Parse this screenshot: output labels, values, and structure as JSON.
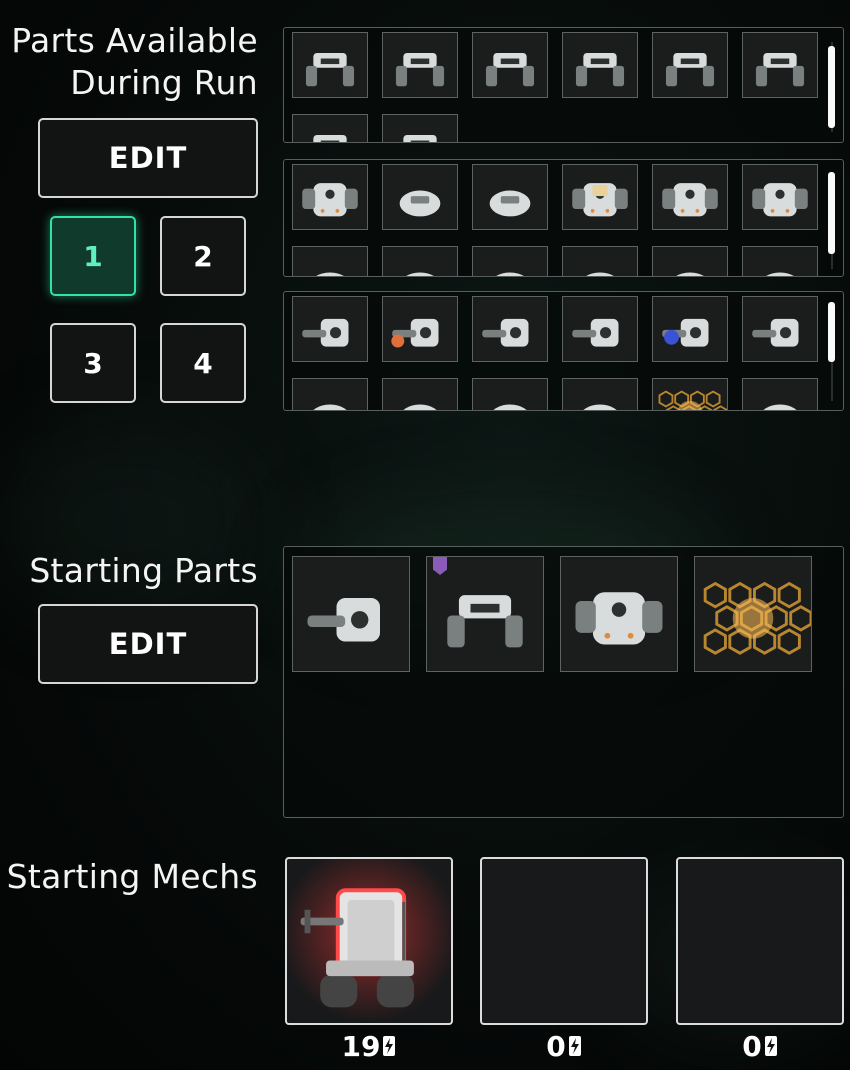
{
  "parts_available": {
    "title_line1": "Parts Available",
    "title_line2": "During Run",
    "edit_label": "EDIT",
    "presets": [
      "1",
      "2",
      "3",
      "4"
    ],
    "active_preset": "1",
    "rows": [
      {
        "name": "legs",
        "items": [
          "tank-tread-legs",
          "hover-legs",
          "jet-legs",
          "flyer-legs",
          "walker-legs",
          "biped-legs",
          "heavy-legs",
          "dome-legs"
        ]
      },
      {
        "name": "bodies",
        "items": [
          "heavy-body",
          "small-body",
          "slim-body",
          "box-body",
          "humanoid-body",
          "orb-body",
          "small-body",
          "dome-body",
          "dome-body",
          "small-body",
          "flat-body",
          "small-body"
        ]
      },
      {
        "name": "weapons",
        "items": [
          "gatling-gun",
          "flame-cannon",
          "rifle",
          "triple-barrel",
          "plasma-gun",
          "twin-cannon",
          "shield-frame",
          "hand-part",
          "turret",
          "turret",
          "hex-shield",
          "box-part"
        ]
      }
    ]
  },
  "starting_parts": {
    "title": "Starting Parts",
    "edit_label": "EDIT",
    "items": [
      "cannon-arm",
      "tank-tread-legs",
      "humanoid-body",
      "hex-shield"
    ],
    "tag_color": "#8a5bb8"
  },
  "starting_mechs": {
    "title": "Starting Mechs",
    "slots": [
      {
        "name": "red-tank-mech",
        "energy": "19"
      },
      {
        "name": "empty",
        "energy": "0"
      },
      {
        "name": "empty",
        "energy": "0"
      }
    ]
  },
  "colors": {
    "accent": "#33e0a6",
    "border": "#d6d6d6"
  }
}
